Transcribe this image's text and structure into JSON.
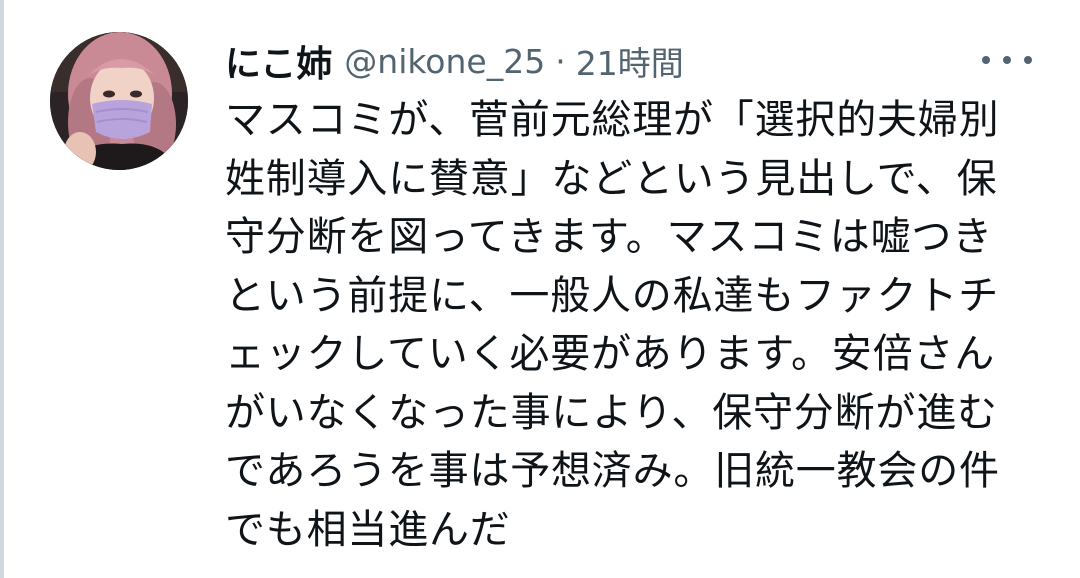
{
  "tweet": {
    "display_name": "にこ姉",
    "handle": "@nikone_25",
    "separator": "·",
    "time": "21時間",
    "body_lines": [
      "マスコミが、菅前元総理が「選択的夫婦別",
      "姓制導入に賛意」などという見出しで、保",
      "守分断を図ってきます。マスコミは嘘つき",
      "という前提に、一般人の私達もファクトチ",
      "ェックしていく必要があります。安倍さん",
      "がいなくなった事により、保守分断が進む",
      "であろうを事は予想済み。旧統一教会の件",
      "でも相当進んだ"
    ]
  },
  "icons": {
    "more": "more-horizontal-icon",
    "avatar": "profile-photo"
  },
  "colors": {
    "text_primary": "#0f1419",
    "text_secondary": "#536471",
    "background": "#ffffff"
  }
}
